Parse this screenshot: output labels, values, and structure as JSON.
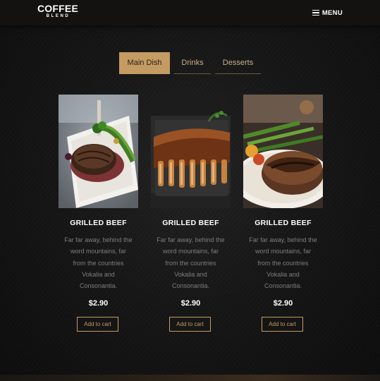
{
  "brand": {
    "name": "COFFEE",
    "tagline": "BLEND"
  },
  "nav": {
    "menu_label": "MENU"
  },
  "tabs": [
    {
      "label": "Main Dish",
      "active": true
    },
    {
      "label": "Drinks",
      "active": false
    },
    {
      "label": "Desserts",
      "active": false
    }
  ],
  "colors": {
    "accent": "#c49b63",
    "background": "#151515",
    "navbar": "#141210"
  },
  "products": [
    {
      "title": "GRILLED BEEF",
      "desc_lines": [
        "Far far away, behind the",
        "word mountains, far",
        "from the countries",
        "Vokalia and",
        "Consonantia."
      ],
      "price": "$2.90",
      "cta": "Add to cart"
    },
    {
      "title": "GRILLED BEEF",
      "desc_lines": [
        "Far far away, behind the",
        "word mountains, far",
        "from the countries",
        "Vokalia and",
        "Consonantia."
      ],
      "price": "$2.90",
      "cta": "Add to cart"
    },
    {
      "title": "GRILLED BEEF",
      "desc_lines": [
        "Far far away, behind the",
        "word mountains, far",
        "from the countries",
        "Vokalia and",
        "Consonantia."
      ],
      "price": "$2.90",
      "cta": "Add to cart"
    }
  ]
}
